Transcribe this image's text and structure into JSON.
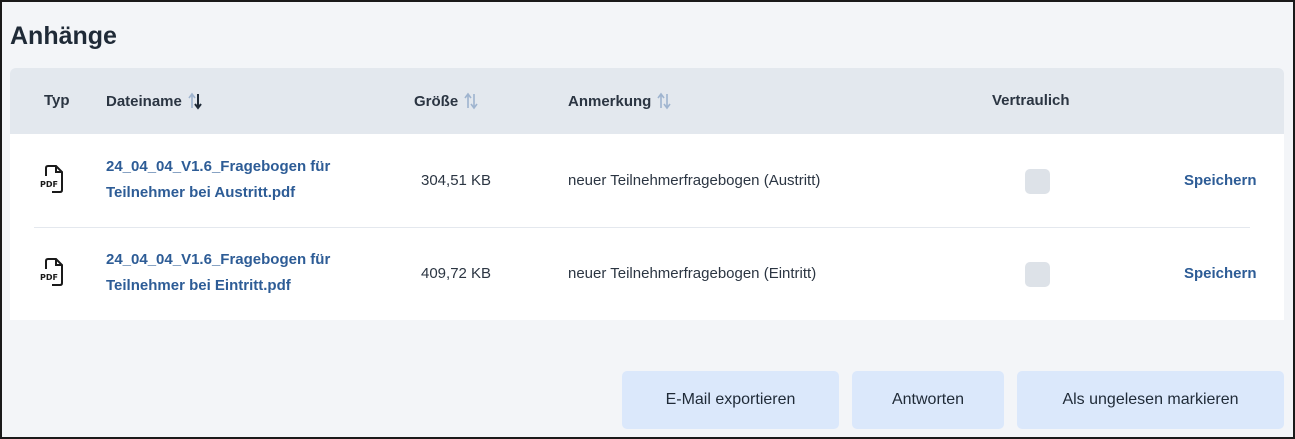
{
  "section": {
    "title": "Anhänge"
  },
  "table": {
    "headers": {
      "type": "Typ",
      "filename": "Dateiname",
      "size": "Größe",
      "note": "Anmerkung",
      "confidential": "Vertraulich"
    },
    "rows": [
      {
        "icon": "pdf-file-icon",
        "filename_line1": "24_04_04_V1.6_Fragebogen für",
        "filename_line2": "Teilnehmer bei Austritt.pdf",
        "size": "304,51 KB",
        "note": "neuer Teilnehmerfragebogen (Austritt)",
        "confidential": false,
        "action": "Speichern"
      },
      {
        "icon": "pdf-file-icon",
        "filename_line1": "24_04_04_V1.6_Fragebogen für",
        "filename_line2": "Teilnehmer bei Eintritt.pdf",
        "size": "409,72 KB",
        "note": "neuer Teilnehmerfragebogen (Eintritt)",
        "confidential": false,
        "action": "Speichern"
      }
    ]
  },
  "actions": {
    "export": "E-Mail exportieren",
    "reply": "Antworten",
    "mark_unread": "Als ungelesen markieren"
  },
  "colors": {
    "link": "#2d5c96",
    "header_bg": "#e3e8ee",
    "button_bg": "#dbe8fb",
    "page_bg": "#f3f5f8"
  }
}
